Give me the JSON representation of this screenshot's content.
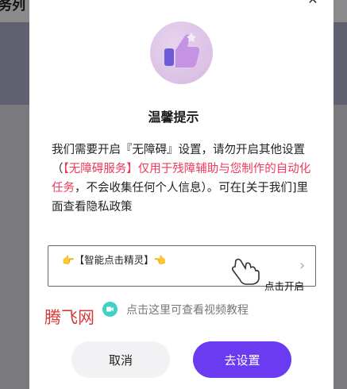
{
  "background": {
    "title": "务列"
  },
  "dialog": {
    "title": "温馨提示",
    "message": {
      "part1": "我们需要开启『无障碍』设置，请勿开启其他设置（",
      "highlight": "【无障碍服务】仅用于残障辅助与您制作的自动化任务",
      "part2": "，不会收集任何个人信息）。可在[关于我们]里面查看隐私政策"
    },
    "guide": {
      "label": "👉【智能点击精灵】👈",
      "click_hint": "点击开启"
    },
    "tutorial_text": "点击这里可查看视频教程",
    "cancel_label": "取消",
    "settings_label": "去设置"
  },
  "watermark": "腾飞网",
  "colors": {
    "accent": "#6a3bf0",
    "highlight": "#ee3a5a",
    "tutorial_icon": "#3fd2c4",
    "hero_circle": "#e0c8eb"
  },
  "icons": [
    "close-icon",
    "thumbs-up-icon",
    "hand-pointer-icon",
    "chevron-right-icon",
    "video-icon"
  ]
}
